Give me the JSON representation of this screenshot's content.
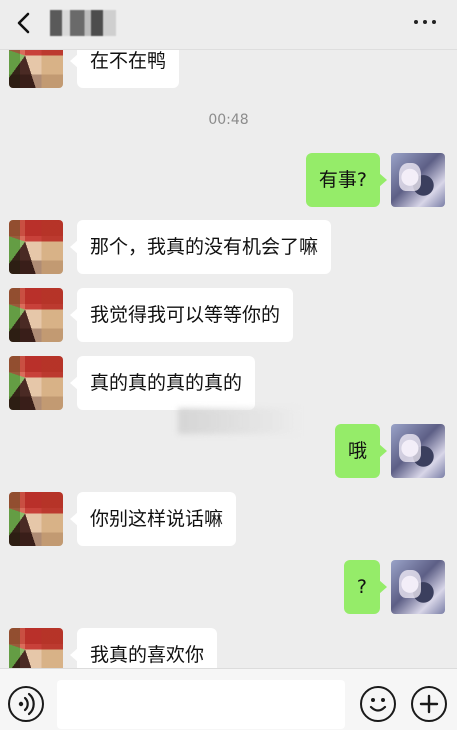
{
  "header": {
    "back_icon": "chevron-left-icon",
    "contact_name": "",
    "more_icon": "more-dots-icon"
  },
  "chat": {
    "timestamp": "00:48",
    "messages": [
      {
        "side": "left",
        "text": "在不在鸭"
      },
      {
        "side": "right",
        "text": "有事?"
      },
      {
        "side": "left",
        "text": "那个，我真的没有机会了嘛"
      },
      {
        "side": "left",
        "text": "我觉得我可以等等你的"
      },
      {
        "side": "left",
        "text": "真的真的真的真的"
      },
      {
        "side": "right",
        "text": "哦"
      },
      {
        "side": "left",
        "text": "你别这样说话嘛"
      },
      {
        "side": "right",
        "text": "?"
      },
      {
        "side": "left",
        "text": "我真的喜欢你"
      }
    ]
  },
  "input_bar": {
    "voice_icon": "voice-icon",
    "input_value": "",
    "emoji_icon": "emoji-icon",
    "plus_icon": "plus-icon"
  },
  "colors": {
    "background": "#ededed",
    "self_bubble": "#95ec69",
    "other_bubble": "#ffffff"
  }
}
